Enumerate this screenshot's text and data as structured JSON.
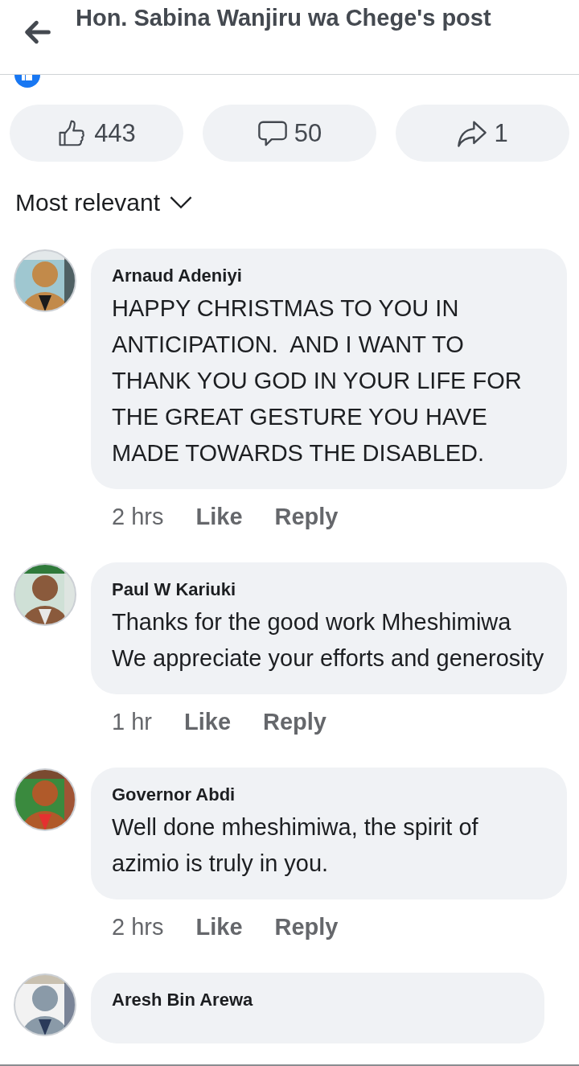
{
  "header": {
    "title": "Hon. Sabina Wanjiru wa Chege's post"
  },
  "actions": [
    {
      "kind": "like",
      "count": "443"
    },
    {
      "kind": "comment",
      "count": "50"
    },
    {
      "kind": "share",
      "count": "1"
    }
  ],
  "sort": {
    "label": "Most relevant"
  },
  "comments": [
    {
      "author": "Arnaud Adeniyi",
      "text": "HAPPY CHRISTMAS TO YOU IN ANTICIPATION.  AND I WANT TO THANK YOU GOD IN YOUR LIFE FOR THE GREAT GESTURE YOU HAVE MADE TOWARDS THE DISABLED.",
      "time": "2 hrs",
      "like": "Like",
      "reply": "Reply"
    },
    {
      "author": "Paul W Kariuki",
      "text": "Thanks for the good work Mheshimiwa We appreciate your efforts and generosity",
      "time": "1 hr",
      "like": "Like",
      "reply": "Reply"
    },
    {
      "author": "Governor Abdi",
      "text": "Well done mheshimiwa, the spirit of azimio is truly in you.",
      "time": "2 hrs",
      "like": "Like",
      "reply": "Reply"
    },
    {
      "author": "Aresh Bin Arewa"
    }
  ]
}
